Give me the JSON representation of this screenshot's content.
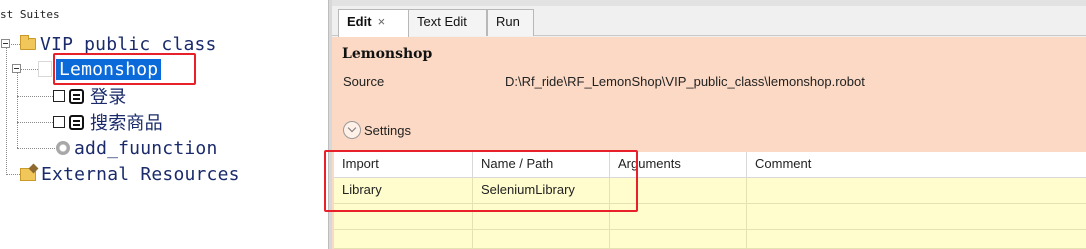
{
  "tree": {
    "header": "st Suites",
    "nodes": {
      "suite": "VIP_public_class",
      "file": "Lemonshop",
      "test1": "登录",
      "test2": "搜索商品",
      "keyword": "add_fuunction",
      "external": "External Resources"
    }
  },
  "tabs": {
    "edit": "Edit",
    "edit_close": "×",
    "text_edit": "Text Edit",
    "run": "Run"
  },
  "editor": {
    "title": "Lemonshop",
    "source_label": "Source",
    "source_value": "D:\\Rf_ride\\RF_LemonShop\\VIP_public_class\\lemonshop.robot",
    "settings_label": "Settings"
  },
  "grid": {
    "columns": [
      "Import",
      "Name / Path",
      "Arguments",
      "Comment"
    ],
    "rows": [
      [
        "Library",
        "SeleniumLibrary",
        "",
        ""
      ]
    ]
  },
  "colors": {
    "selection": "#0a6ad9",
    "highlight_box": "#e8202a",
    "content_bg": "#fbd9c4",
    "grid_bg": "#fffccd"
  }
}
